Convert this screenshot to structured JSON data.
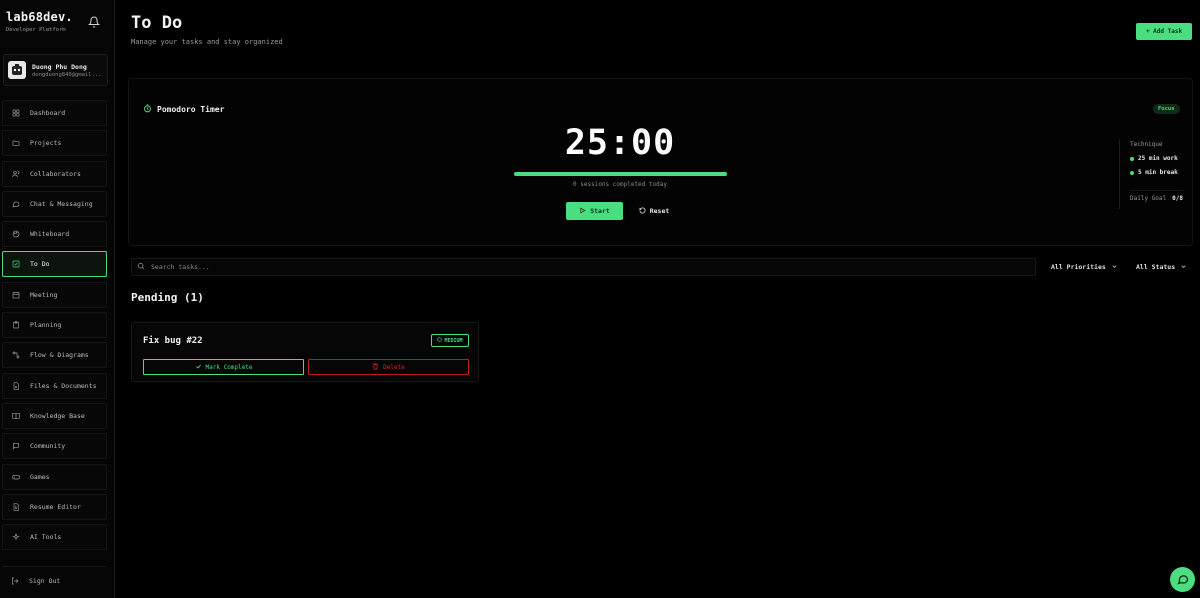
{
  "brand": {
    "name": "lab68dev.",
    "subtitle": "Developer Platform"
  },
  "user": {
    "name": "Duong Phu Dong",
    "email": "dongduong840@gmail..."
  },
  "nav": {
    "items": [
      {
        "label": "Dashboard",
        "icon": "grid-icon"
      },
      {
        "label": "Projects",
        "icon": "folder-icon"
      },
      {
        "label": "Collaborators",
        "icon": "users-icon"
      },
      {
        "label": "Chat & Messaging",
        "icon": "message-icon"
      },
      {
        "label": "Whiteboard",
        "icon": "palette-icon"
      },
      {
        "label": "To Do",
        "icon": "checkbox-icon",
        "active": true
      },
      {
        "label": "Meeting",
        "icon": "calendar-icon"
      },
      {
        "label": "Planning",
        "icon": "clipboard-icon"
      },
      {
        "label": "Flow & Diagrams",
        "icon": "flow-icon"
      },
      {
        "label": "Files & Documents",
        "icon": "file-icon"
      },
      {
        "label": "Knowledge Base",
        "icon": "book-icon"
      },
      {
        "label": "Community",
        "icon": "chat-bubble-icon"
      },
      {
        "label": "Games",
        "icon": "gamepad-icon"
      },
      {
        "label": "Resume Editor",
        "icon": "document-icon"
      },
      {
        "label": "AI Tools",
        "icon": "sparkle-icon"
      }
    ],
    "signout": "Sign Out"
  },
  "header": {
    "title": "To Do",
    "subtitle": "Manage your tasks and stay organized",
    "add_label": "+ Add Task"
  },
  "pomodoro": {
    "title": "Pomodoro Timer",
    "mode_badge": "Focus",
    "time": "25:00",
    "progress": 1.0,
    "sessions_text": "0 sessions completed today",
    "start_label": "Start",
    "reset_label": "Reset",
    "technique": {
      "title": "Technique",
      "work": "25 min work",
      "break": "5 min break",
      "goal_label": "Daily Goal",
      "goal_value": "0/8"
    }
  },
  "filters": {
    "search_placeholder": "Search tasks...",
    "priority": "All Priorities",
    "status": "All Status"
  },
  "pending": {
    "heading": "Pending (1)",
    "tasks": [
      {
        "title": "Fix bug #22",
        "priority": "MEDIUM",
        "complete_label": "Mark Complete",
        "delete_label": "Delete"
      }
    ]
  },
  "colors": {
    "accent": "#4ade80",
    "danger": "#dc2626",
    "background": "#000000"
  }
}
